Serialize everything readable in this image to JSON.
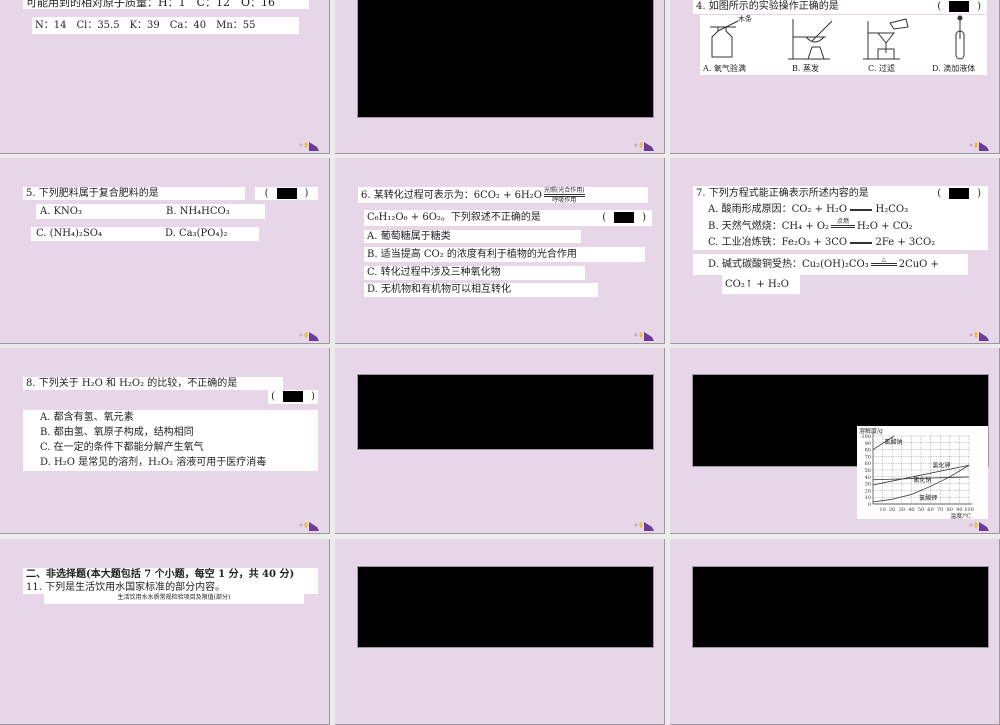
{
  "slides": {
    "s1": {
      "line1": "可能用到的相对原子质量：H：1　C：12　O：16",
      "line2": "N：14　Cl：35.5　K：39　Ca：40　Mn：55"
    },
    "s3": {
      "title": "4. 如图所示的实验操作正确的是",
      "bracket_open": "(",
      "bracket_close": ")",
      "wood_label": "木条",
      "options": [
        "A. 氧气验满",
        "B. 蒸发",
        "C. 过滤",
        "D. 滴加液体"
      ]
    },
    "s4": {
      "title": "5. 下列肥料属于复合肥料的是",
      "bracket_open": "(",
      "bracket_close": ")",
      "options": [
        "A. KNO₃",
        "B. NH₄HCO₃",
        "C. (NH₄)₂SO₄",
        "D. Ca₃(PO₄)₂"
      ]
    },
    "s5": {
      "title_prefix": "6. 某转化过程可表示为：6CO₂ + 6H₂O",
      "cond_top": "光照(光合作用)",
      "cond_bottom": "呼吸作用",
      "line2": "C₆H₁₂O₆ + 6O₂。下列叙述不正确的是",
      "bracket_open": "(",
      "bracket_close": ")",
      "options": [
        "A. 葡萄糖属于糖类",
        "B. 适当提高 CO₂ 的浓度有利于植物的光合作用",
        "C. 转化过程中涉及三种氧化物",
        "D. 无机物和有机物可以相互转化"
      ]
    },
    "s6": {
      "title": "7. 下列方程式能正确表示所述内容的是",
      "bracket_open": "(",
      "bracket_close": ")",
      "a": {
        "left": "A. 酸雨形成原因：CO₂ + H₂O",
        "right": "H₂CO₃"
      },
      "b": {
        "left": "B. 天然气燃烧：CH₄ + O₂",
        "cond": "点燃",
        "right": "H₂O + CO₂"
      },
      "c": {
        "left": "C. 工业冶炼铁：Fe₂O₃ + 3CO",
        "right": "2Fe + 3CO₂"
      },
      "d": {
        "left": "D. 碱式碳酸铜受热：Cu₂(OH)₂CO₃",
        "cond": "△",
        "right": "2CuO +",
        "cont": "CO₂↑ + H₂O"
      }
    },
    "s7": {
      "title": "8. 下列关于 H₂O 和 H₂O₂ 的比较，不正确的是",
      "bracket_open": "(",
      "bracket_close": ")",
      "options": [
        "A. 都含有氢、氧元素",
        "B. 都由氢、氧原子构成，结构相同",
        "C. 在一定的条件下都能分解产生氧气",
        "D. H₂O 是常见的溶剂，H₂O₂ 溶液可用于医疗消毒"
      ]
    },
    "s10": {
      "section": "二、非选择题(本大题包括 7 个小题，每空 1 分，共 40 分)",
      "q11": "11. 下列是生活饮用水国家标准的部分内容。",
      "caption": "生活饮用水水质常规检验项目及限值(部分)"
    }
  },
  "colors": {
    "slide_bg": "#e6d6e8",
    "gap": "#ebebeb",
    "logo_purple": "#6a3c95",
    "logo_yellow": "#e8c040"
  },
  "chart_data": {
    "type": "line",
    "ylabel": "溶解度/g",
    "xlabel": "温度/℃",
    "xlim": [
      0,
      100
    ],
    "ylim": [
      0,
      100
    ],
    "grid": true,
    "xticks": [
      10,
      20,
      30,
      40,
      50,
      60,
      70,
      80,
      90,
      100
    ],
    "yticks": [
      0,
      10,
      20,
      30,
      40,
      50,
      60,
      70,
      80,
      90,
      100
    ],
    "series": [
      {
        "name": "氯酸钠",
        "x": [
          0,
          22
        ],
        "y": [
          80,
          100
        ],
        "label_at": [
          12,
          88
        ]
      },
      {
        "name": "氯化钾",
        "x": [
          0,
          100
        ],
        "y": [
          28,
          57
        ],
        "label_at": [
          62,
          54
        ]
      },
      {
        "name": "氯化钠",
        "x": [
          0,
          100
        ],
        "y": [
          35.7,
          39.8
        ],
        "label_at": [
          42,
          32
        ]
      },
      {
        "name": "氯酸钾",
        "x": [
          0,
          20,
          40,
          60,
          80,
          100
        ],
        "y": [
          3,
          7,
          14,
          26,
          40,
          57
        ],
        "label_at": [
          48,
          6
        ]
      }
    ]
  }
}
